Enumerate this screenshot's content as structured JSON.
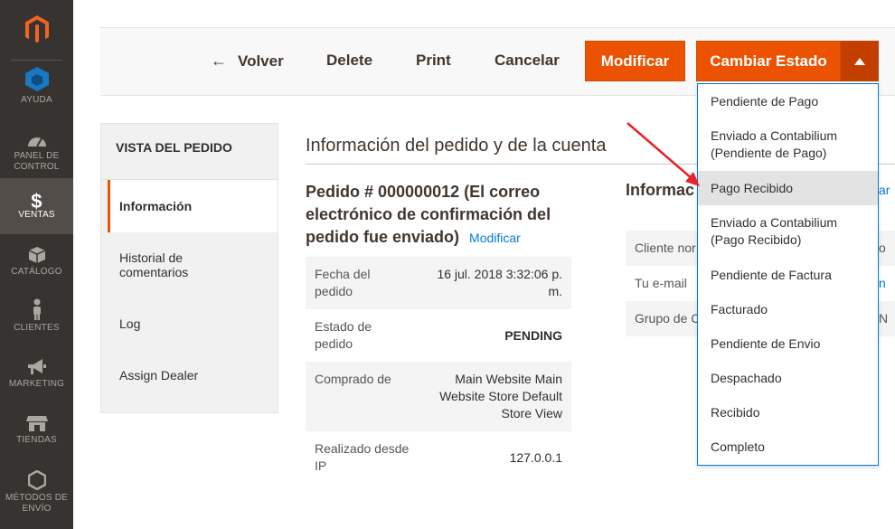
{
  "sidebar": {
    "items": [
      {
        "label": "AYUDA",
        "icon": "cube-icon"
      },
      {
        "label": "PANEL DE CONTROL",
        "icon": "dashboard-icon"
      },
      {
        "label": "VENTAS",
        "icon": "dollar-icon"
      },
      {
        "label": "CATÁLOGO",
        "icon": "box-icon"
      },
      {
        "label": "CLIENTES",
        "icon": "person-icon"
      },
      {
        "label": "MARKETING",
        "icon": "megaphone-icon"
      },
      {
        "label": "TIENDAS",
        "icon": "store-icon"
      },
      {
        "label": "MÉTODOS DE ENVÍO",
        "icon": "hexagon-icon"
      }
    ]
  },
  "toolbar": {
    "back_label": "Volver",
    "delete_label": "Delete",
    "print_label": "Print",
    "cancel_label": "Cancelar",
    "edit_label": "Modificar",
    "change_status_label": "Cambiar Estado"
  },
  "status_menu": {
    "items": [
      "Pendiente de Pago",
      "Enviado a Contabilium (Pendiente de Pago)",
      "Pago Recibido",
      "Enviado a Contabilium (Pago Recibido)",
      "Pendiente de Factura",
      "Facturado",
      "Pendiente de Envio",
      "Despachado",
      "Recibido",
      "Completo"
    ],
    "highlighted": "Pago Recibido"
  },
  "tabs": {
    "title": "VISTA DEL PEDIDO",
    "items": [
      "Información",
      "Historial de comentarios",
      "Log",
      "Assign Dealer"
    ]
  },
  "main": {
    "section_title": "Información del pedido y de la cuenta",
    "order_title": "Pedido # 000000012 (El correo electrónico de confirmación del pedido fue enviado)",
    "order_edit_link": "Modificar",
    "order_info": [
      {
        "label": "Fecha del pedido",
        "value": "16 jul. 2018 3:32:06 p. m."
      },
      {
        "label": "Estado de pedido",
        "value": "PENDING"
      },
      {
        "label": "Comprado de",
        "value": "Main Website Main Website Store Default Store View"
      },
      {
        "label": "Realizado desde IP",
        "value": "127.0.0.1"
      }
    ],
    "account_title": "Informac",
    "account_edit_fragment": "ar",
    "account_rows": [
      {
        "label": "Cliente nor",
        "value": "o"
      },
      {
        "label": "Tu e-mail",
        "value": "n"
      },
      {
        "label": "Grupo de C",
        "value": "N"
      }
    ]
  },
  "colors": {
    "accent": "#eb5202",
    "sidebar_bg": "#373330",
    "link": "#007bdb",
    "annotation_arrow": "#e8232a"
  }
}
